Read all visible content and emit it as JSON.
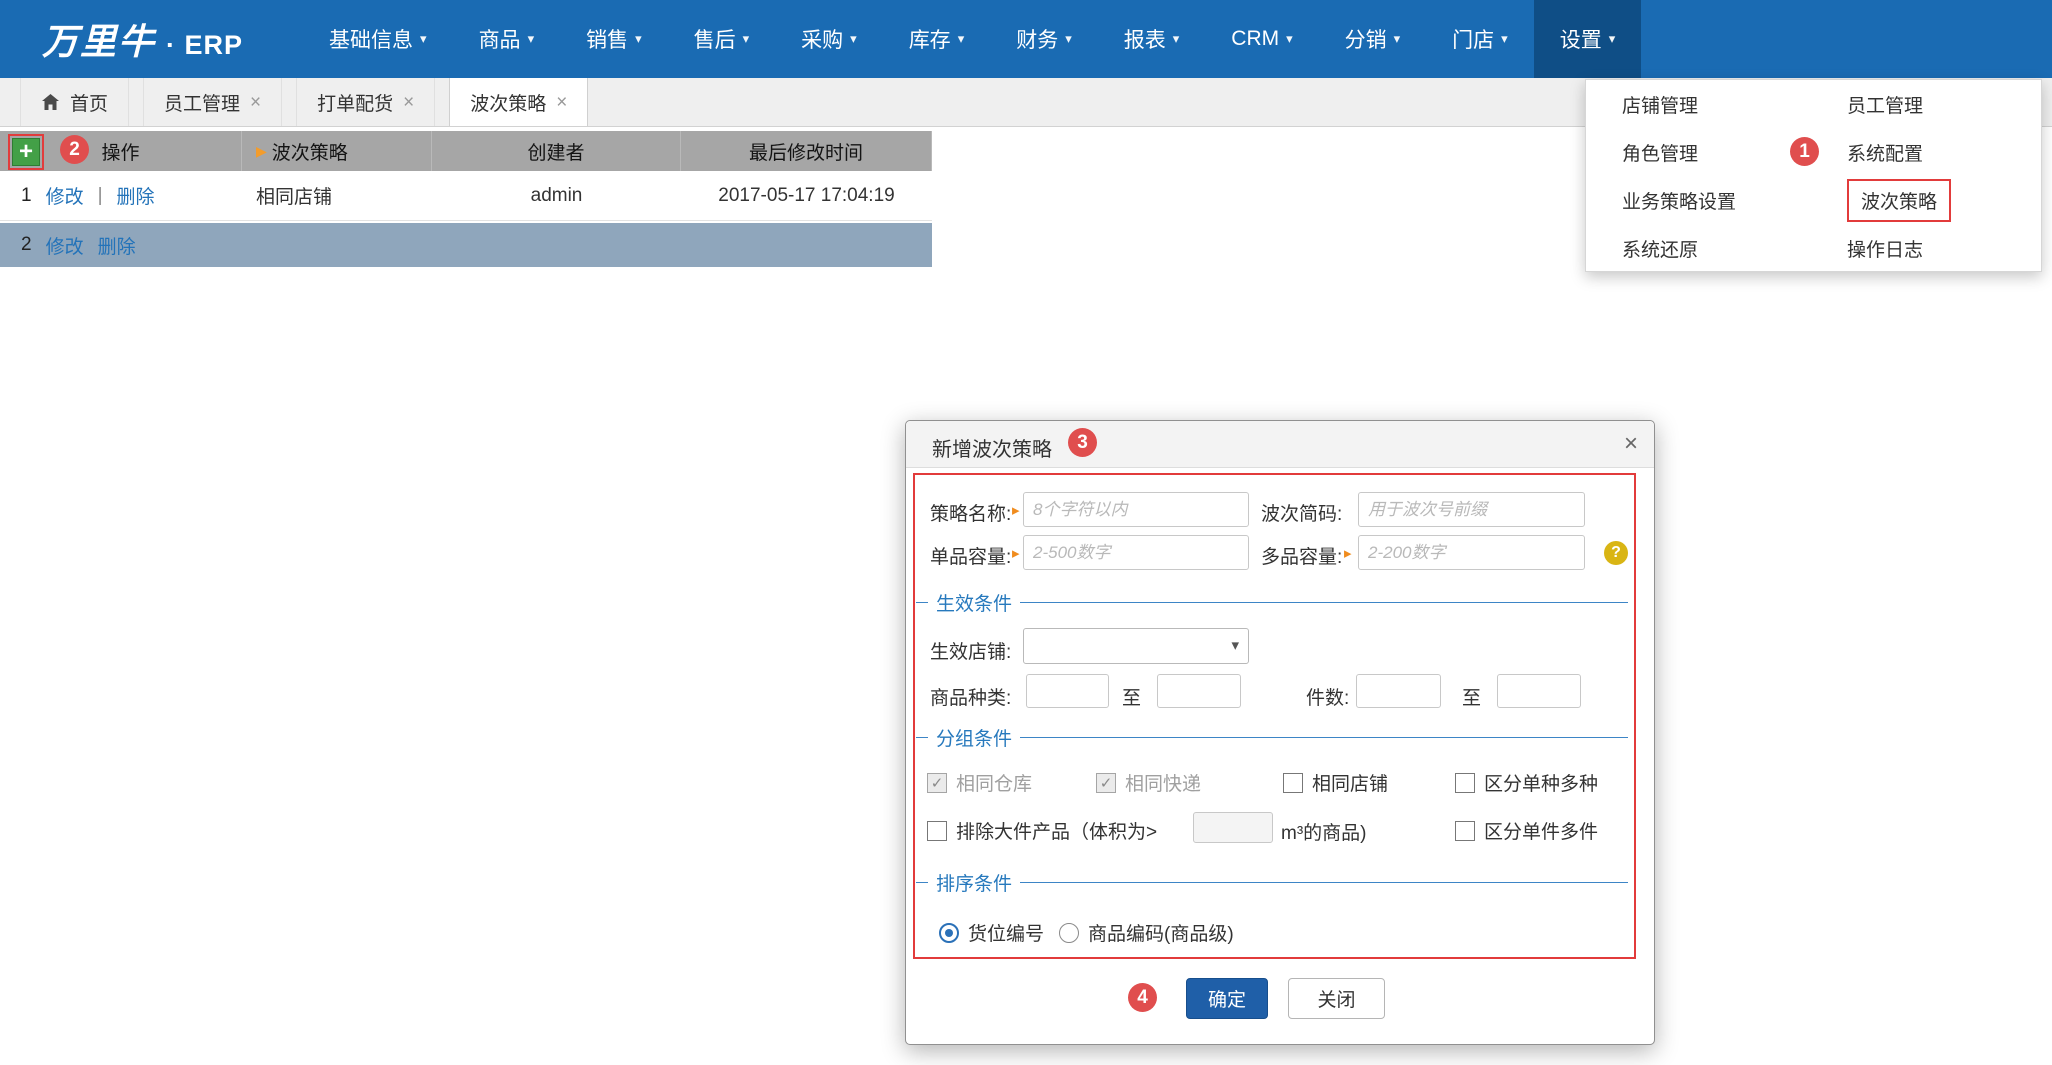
{
  "nav": {
    "logo": "万里牛",
    "logo_suffix": "· ERP",
    "items": [
      "基础信息",
      "商品",
      "销售",
      "售后",
      "采购",
      "库存",
      "财务",
      "报表",
      "CRM",
      "分销",
      "门店",
      "设置"
    ]
  },
  "tabs": {
    "items": [
      "首页",
      "员工管理",
      "打单配货",
      "波次策略"
    ]
  },
  "settings_menu": {
    "items": [
      "店铺管理",
      "员工管理",
      "角色管理",
      "系统配置",
      "业务策略设置",
      "波次策略",
      "系统还原",
      "操作日志"
    ]
  },
  "table": {
    "headers": [
      "操作",
      "波次策略",
      "创建者",
      "最后修改时间"
    ],
    "action_edit": "修改",
    "action_delete": "删除",
    "separator": "|",
    "rows": [
      {
        "index": "1",
        "strategy": "相同店铺",
        "creator": "admin",
        "modified": "2017-05-17 17:04:19"
      },
      {
        "index": "2",
        "strategy": "",
        "creator": "",
        "modified": ""
      }
    ]
  },
  "modal": {
    "title": "新增波次策略",
    "rows": {
      "strategy_name": {
        "label": "策略名称:",
        "placeholder": "8个字符以内"
      },
      "batch_code": {
        "label": "波次简码:",
        "placeholder": "用于波次号前缀"
      },
      "single_capacity": {
        "label": "单品容量:",
        "placeholder": "2-500数字"
      },
      "multi_capacity": {
        "label": "多品容量:",
        "placeholder": "2-200数字"
      },
      "effective_shop": {
        "label": "生效店铺:"
      },
      "product_kinds": {
        "label": "商品种类:"
      },
      "piece_count": {
        "label": "件数:"
      },
      "to": "至"
    },
    "sections": {
      "effective": "生效条件",
      "grouping": "分组条件",
      "sorting": "排序条件"
    },
    "checkboxes": [
      {
        "label": "相同仓库",
        "checked": true,
        "disabled": true
      },
      {
        "label": "相同快递",
        "checked": true,
        "disabled": true
      },
      {
        "label": "相同店铺",
        "checked": false
      },
      {
        "label": "区分单种多种",
        "checked": false
      },
      {
        "label": "排除大件产品（体积为>",
        "checked": false
      },
      {
        "label": "区分单件多件",
        "checked": false
      }
    ],
    "volume_unit_suffix": "m³的商品)",
    "radios": [
      {
        "label": "货位编号",
        "selected": true
      },
      {
        "label": "商品编码(商品级)",
        "selected": false
      }
    ],
    "buttons": {
      "ok": "确定",
      "close": "关闭"
    }
  },
  "annotations": {
    "step1": "1",
    "step2": "2",
    "step3": "3",
    "step4": "4"
  },
  "icons": {
    "caret_down": "▾",
    "select_caret": "▾",
    "close": "×",
    "tab_close": "×",
    "plus": "+",
    "help": "?",
    "required_arrow": "▸",
    "header_arrow": "▶",
    "separator": "|"
  },
  "colors": {
    "nav_blue": "#1a6bb3",
    "nav_active_blue": "#0f4e86",
    "annotation_red": "#e04e4e",
    "outline_red": "#e23b3b",
    "link_blue": "#2373b9",
    "selected_row": "#8fa6bc",
    "header_gray": "#a6a6a6",
    "ok_button_blue": "#1f5fa8",
    "section_blue": "#2779bd",
    "required_orange": "#f08c1e",
    "help_yellow": "#d9b514",
    "plus_green": "#43a047"
  }
}
